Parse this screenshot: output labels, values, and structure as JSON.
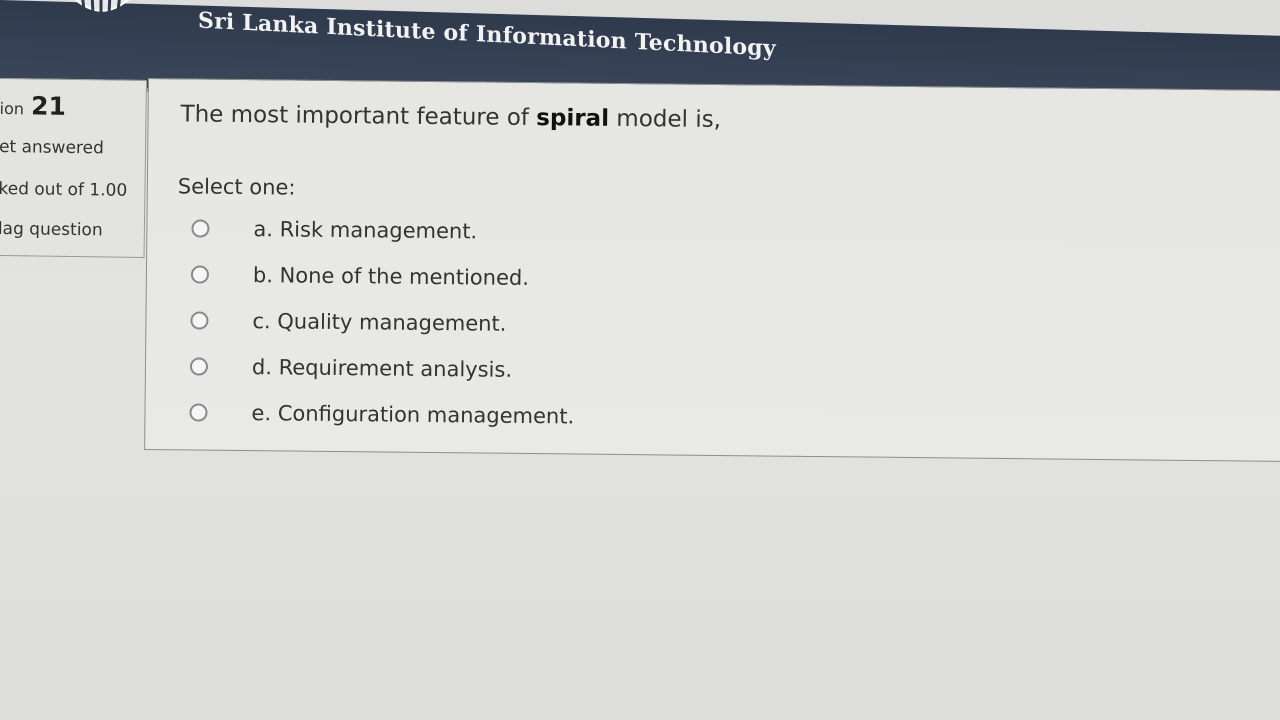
{
  "header": {
    "institution": "Sri Lanka Institute of Information Technology",
    "colors": {
      "bar": "#343f52",
      "accent": "#d9863d"
    }
  },
  "info": {
    "question_prefix": "ion",
    "question_number": "21",
    "status": "et answered",
    "marks": "ked out of 1.00",
    "flag": "lag question"
  },
  "question": {
    "text_before": "The most important feature of ",
    "text_bold": "spiral",
    "text_after": " model is,",
    "select_prompt": "Select one:",
    "options": [
      {
        "label": "a. Risk management."
      },
      {
        "label": "b. None of the mentioned."
      },
      {
        "label": "c. Quality management."
      },
      {
        "label": "d. Requirement analysis."
      },
      {
        "label": "e. Configuration management."
      }
    ]
  }
}
